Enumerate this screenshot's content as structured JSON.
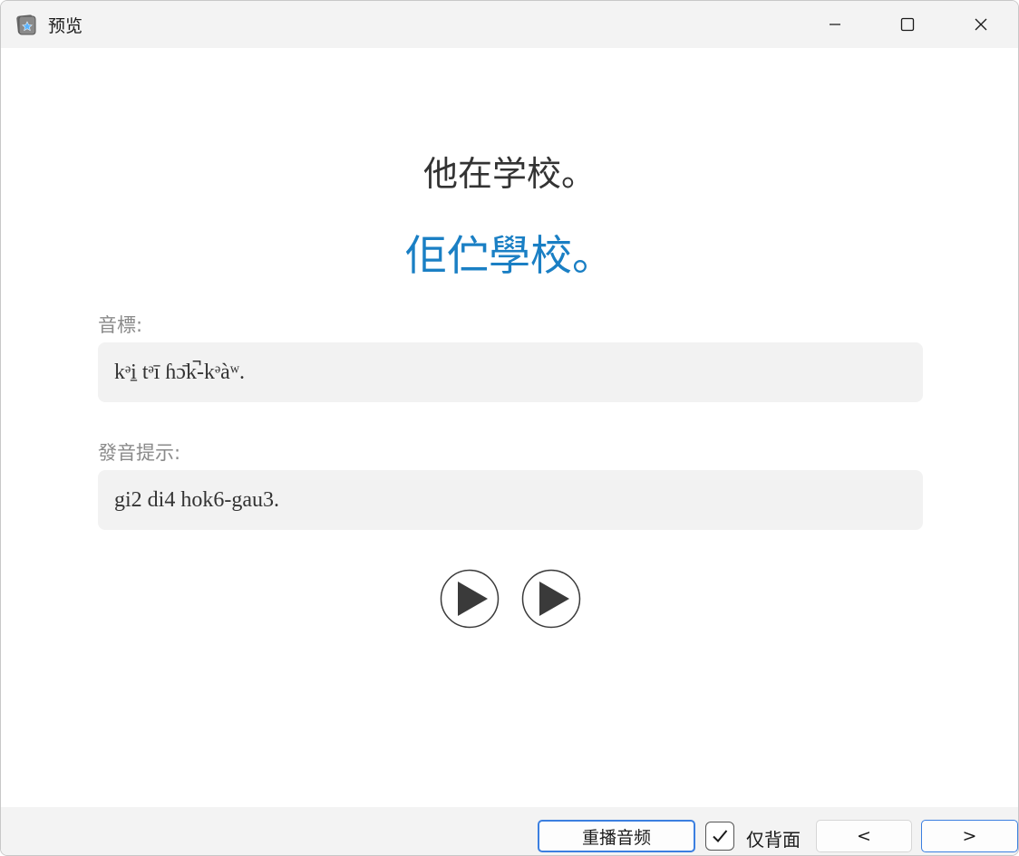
{
  "window": {
    "title": "预览"
  },
  "card": {
    "front": "他在学校。",
    "back": "佢伫學校。",
    "ipa_label": "音標:",
    "ipa_value": "kᵊi̠ tᵊī ɦɔ̄k̚-kᵊàʷ.",
    "hint_label": "發音提示:",
    "hint_value": "gi2 di4 hok6-gau3."
  },
  "audio": {
    "buttons": [
      "play-audio-1",
      "play-audio-2"
    ]
  },
  "footer": {
    "replay_label": "重播音频",
    "back_only_label": "仅背面",
    "back_only_checked": true,
    "prev_label": "<",
    "next_label": ">"
  },
  "colors": {
    "accent": "#1a7fc4",
    "focus_border": "#3b7fe0",
    "field_bg": "#f2f2f2",
    "label_gray": "#8a8a8a"
  }
}
